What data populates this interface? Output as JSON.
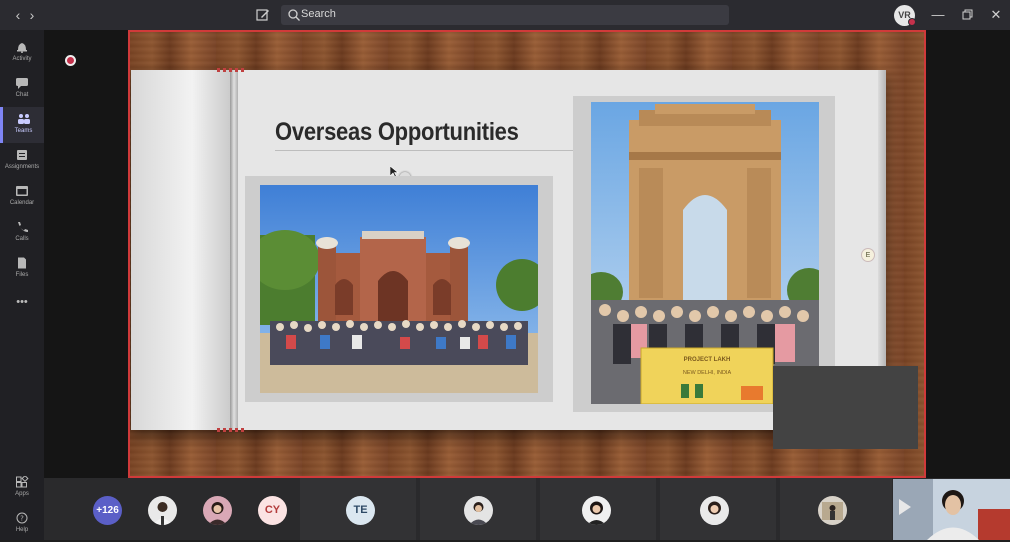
{
  "titlebar": {
    "back_icon": "chevron-left-icon",
    "forward_icon": "chevron-right-icon",
    "compose_icon": "compose-icon",
    "search_placeholder": "Search",
    "user_initials": "VR",
    "window_controls": [
      "minimize-icon",
      "restore-icon",
      "close-icon"
    ]
  },
  "rail": {
    "items": [
      {
        "label": "Activity",
        "icon": "bell-icon"
      },
      {
        "label": "Chat",
        "icon": "chat-icon"
      },
      {
        "label": "Teams",
        "icon": "teams-icon",
        "active": true
      },
      {
        "label": "Assignments",
        "icon": "assignments-icon"
      },
      {
        "label": "Calendar",
        "icon": "calendar-icon"
      },
      {
        "label": "Calls",
        "icon": "phone-icon"
      },
      {
        "label": "Files",
        "icon": "files-icon"
      },
      {
        "label": "•••",
        "icon": "more-icon"
      },
      {
        "label": "Apps",
        "icon": "apps-icon"
      },
      {
        "label": "Help",
        "icon": "help-icon"
      }
    ]
  },
  "slide": {
    "title": "Overseas Opportunities",
    "page_marker": "E",
    "banner_line1": "PROJECT LAKH",
    "banner_line2": "NEW DELHI, INDIA"
  },
  "participants": {
    "overflow_count": "+126",
    "initials": [
      "CY",
      "TE"
    ]
  },
  "colors": {
    "accent": "#5b5fc7",
    "recording": "#c4314b",
    "share_border": "#d03a3a"
  }
}
